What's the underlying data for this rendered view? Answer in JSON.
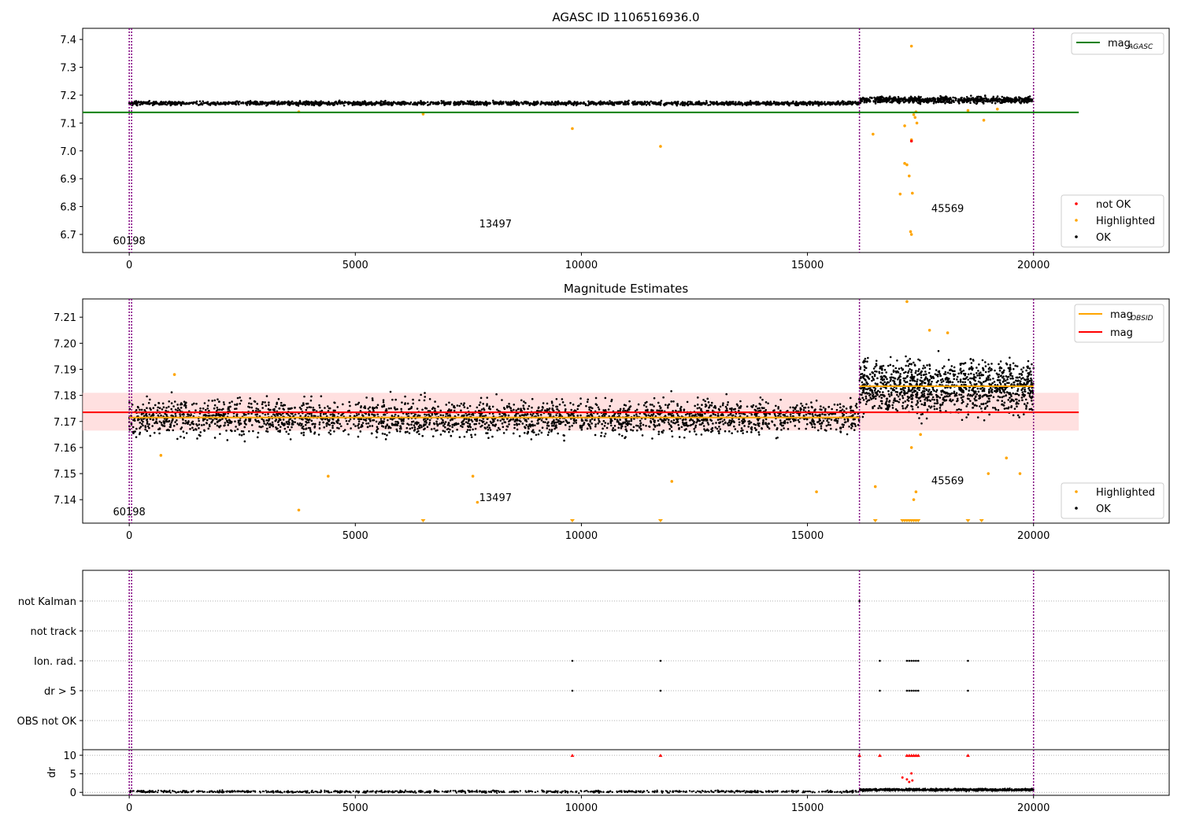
{
  "chart_data": [
    {
      "type": "scatter",
      "title": "AGASC ID 1106516936.0",
      "xlim": [
        -1030,
        23000
      ],
      "ylim": [
        6.635,
        7.44
      ],
      "xticks": [
        0,
        5000,
        10000,
        15000,
        20000
      ],
      "yticks": [
        6.7,
        6.8,
        6.9,
        7.0,
        7.1,
        7.2,
        7.3,
        7.4
      ],
      "ytick_labels": [
        "6.7",
        "6.8",
        "6.9",
        "7.0",
        "7.1",
        "7.2",
        "7.3",
        "7.4"
      ],
      "observation_boundaries": [
        0,
        16150,
        20000
      ],
      "obsid_labels": [
        {
          "x": 0,
          "y": 6.665,
          "text": "60198"
        },
        {
          "x": 8100,
          "y": 6.725,
          "text": "13497"
        },
        {
          "x": 18100,
          "y": 6.78,
          "text": "45569"
        }
      ],
      "mag_agasc": 7.138,
      "legend_upper": [
        {
          "label": "mag",
          "subscript": "AGASC",
          "color": "#008000",
          "kind": "line"
        }
      ],
      "legend_lower": [
        {
          "label": "not OK",
          "color": "#ff0000",
          "kind": "point"
        },
        {
          "label": "Highlighted",
          "color": "#ffa500",
          "kind": "point"
        },
        {
          "label": "OK",
          "color": "#000000",
          "kind": "point"
        }
      ],
      "series": [
        {
          "name": "OK",
          "color": "#000000",
          "segments": [
            {
              "x": [
                0,
                16150
              ],
              "center": 7.171,
              "spread": 0.006
            },
            {
              "x": [
                16150,
                20000
              ],
              "center": 7.183,
              "spread": 0.01
            }
          ]
        },
        {
          "name": "Highlighted",
          "color": "#ffa500",
          "x": [
            3750,
            6500,
            9800,
            11750,
            16450,
            17050,
            17150,
            17200,
            17250,
            17280,
            17300,
            17320,
            17350,
            17380,
            17400,
            17420,
            17300,
            17300,
            17150,
            18550,
            18900,
            19200
          ],
          "y": [
            7.14,
            7.132,
            7.08,
            7.016,
            7.06,
            6.845,
            6.955,
            6.95,
            6.91,
            6.71,
            6.7,
            6.848,
            7.13,
            7.12,
            7.14,
            7.1,
            7.376,
            7.04,
            7.09,
            7.145,
            7.11,
            7.15
          ]
        },
        {
          "name": "not OK",
          "color": "#ff0000",
          "x": [
            17300
          ],
          "y": [
            7.035
          ]
        }
      ]
    },
    {
      "type": "scatter",
      "title": "Magnitude Estimates",
      "xlim": [
        -1030,
        23000
      ],
      "ylim": [
        7.131,
        7.217
      ],
      "xticks": [
        0,
        5000,
        10000,
        15000,
        20000
      ],
      "yticks": [
        7.14,
        7.15,
        7.16,
        7.17,
        7.18,
        7.19,
        7.2,
        7.21
      ],
      "ytick_labels": [
        "7.14",
        "7.15",
        "7.16",
        "7.17",
        "7.18",
        "7.19",
        "7.20",
        "7.21"
      ],
      "observation_boundaries": [
        0,
        16150,
        20000
      ],
      "obsid_labels": [
        {
          "x": 0,
          "y": 7.134,
          "text": "60198"
        },
        {
          "x": 8100,
          "y": 7.1395,
          "text": "13497"
        },
        {
          "x": 18100,
          "y": 7.146,
          "text": "45569"
        }
      ],
      "mag": 7.1735,
      "mag_band": [
        7.1665,
        7.181
      ],
      "mag_obsid": [
        {
          "x": [
            0,
            16150
          ],
          "y": 7.1715
        },
        {
          "x": [
            16150,
            20000
          ],
          "y": 7.1835
        }
      ],
      "legend_upper": [
        {
          "label": "mag",
          "subscript": "OBSID",
          "color": "#ffa500",
          "kind": "line"
        },
        {
          "label": "mag",
          "color": "#ff0000",
          "kind": "line"
        }
      ],
      "legend_lower": [
        {
          "label": "Highlighted",
          "color": "#ffa500",
          "kind": "point"
        },
        {
          "label": "OK",
          "color": "#000000",
          "kind": "point"
        }
      ],
      "series": [
        {
          "name": "OK",
          "color": "#000000",
          "segments": [
            {
              "x": [
                0,
                16150
              ],
              "center": 7.1715,
              "spread": 0.006
            },
            {
              "x": [
                16150,
                20000
              ],
              "center": 7.1835,
              "spread": 0.009
            }
          ]
        },
        {
          "name": "Highlighted",
          "color": "#ffa500",
          "x": [
            700,
            1000,
            3750,
            4400,
            7600,
            7700,
            12000,
            15200,
            16500,
            17300,
            17350,
            17400,
            17500,
            17700,
            18100,
            19000,
            19400,
            19700,
            17200
          ],
          "y": [
            7.157,
            7.188,
            7.136,
            7.149,
            7.149,
            7.139,
            7.147,
            7.143,
            7.145,
            7.16,
            7.14,
            7.143,
            7.165,
            7.205,
            7.204,
            7.15,
            7.156,
            7.15,
            7.216
          ]
        }
      ],
      "clipped_markers_x": [
        6500,
        9800,
        11750,
        16500,
        17100,
        17150,
        17200,
        17250,
        17300,
        17350,
        17400,
        17450,
        18550,
        18850
      ]
    },
    {
      "type": "scatter",
      "title": "",
      "xlim": [
        -1030,
        23000
      ],
      "flag_rows": [
        "not Kalman",
        "not track",
        "Ion. rad.",
        "dr > 5",
        "OBS not OK"
      ],
      "observation_boundaries": [
        0,
        16150,
        20000
      ],
      "flags": {
        "not Kalman": [
          16150
        ],
        "not track": [],
        "Ion. rad.": [
          9800,
          11750,
          16600,
          17200,
          17250,
          17300,
          17350,
          17400,
          17450,
          18550
        ],
        "dr > 5": [
          9800,
          11750,
          16600,
          17200,
          17250,
          17300,
          17350,
          17400,
          17450,
          18550
        ],
        "OBS not OK": []
      }
    },
    {
      "type": "scatter",
      "title": "",
      "xlim": [
        -1030,
        23000
      ],
      "ylim": [
        -0.8,
        11.5
      ],
      "xticks": [
        0,
        5000,
        10000,
        15000,
        20000
      ],
      "yticks": [
        0,
        5,
        10
      ],
      "ytick_labels": [
        "0",
        "5",
        "10"
      ],
      "ylabel": "dr",
      "observation_boundaries": [
        0,
        16150,
        20000
      ],
      "clip_value": 10,
      "clipped_x": [
        9800,
        11750,
        16150,
        16600,
        17200,
        17250,
        17300,
        17350,
        17400,
        17450,
        18550
      ],
      "large_dr": {
        "x": [
          17100,
          17200,
          17250,
          17300,
          17320
        ],
        "y": [
          4.0,
          3.5,
          2.8,
          5.1,
          3.2
        ]
      },
      "series_center": [
        {
          "x": [
            0,
            16150
          ],
          "y": 0.2
        },
        {
          "x": [
            16150,
            20000
          ],
          "y": 0.7
        }
      ]
    }
  ]
}
